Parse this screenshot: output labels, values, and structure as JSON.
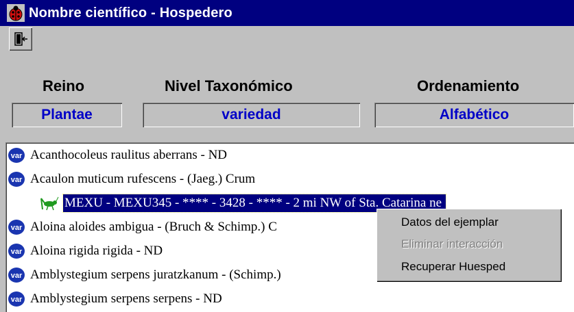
{
  "window": {
    "title": "Nombre científico - Hospedero",
    "title_icon": "ladybug-icon"
  },
  "toolbar": {
    "exit_icon": "door-exit-icon"
  },
  "headers": {
    "reino": "Reino",
    "nivel": "Nivel Taxonómico",
    "orden": "Ordenamiento"
  },
  "fields": {
    "reino": "Plantae",
    "nivel": "variedad",
    "orden": "Alfabético"
  },
  "list": {
    "rows": [
      {
        "icon": "var-icon",
        "text": "Acanthocoleus raulitus aberrans - ND"
      },
      {
        "icon": "var-icon",
        "text": "Acaulon muticum rufescens - (Jaeg.) Crum"
      },
      {
        "icon": "grasshopper-icon",
        "text": "MEXU - MEXU345 - **** -  3428 - **** - 2 mi NW of Sta. Catarina ne",
        "selected": true
      },
      {
        "icon": "var-icon",
        "text": "Aloina aloides ambigua - (Bruch & Schimp.) C"
      },
      {
        "icon": "var-icon",
        "text": "Aloina rigida rigida - ND"
      },
      {
        "icon": "var-icon",
        "text": "Amblystegium serpens juratzkanum - (Schimp.)"
      },
      {
        "icon": "var-icon",
        "text": "Amblystegium serpens serpens - ND"
      }
    ]
  },
  "context_menu": {
    "items": [
      {
        "label": "Datos del ejemplar",
        "enabled": true
      },
      {
        "label": "Eliminar interacción",
        "enabled": false
      },
      {
        "label": "Recuperar Huesped",
        "enabled": true
      }
    ]
  },
  "colors": {
    "title_bg": "#000080",
    "field_text": "#0000c8",
    "icon_blue": "#1a35b0"
  }
}
